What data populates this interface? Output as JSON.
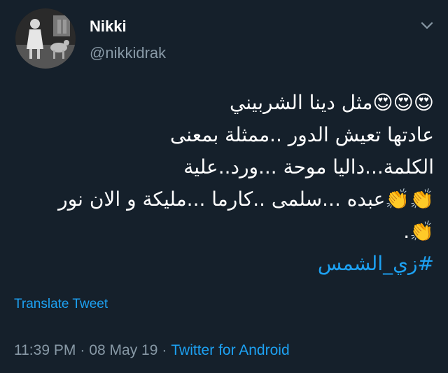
{
  "author": {
    "display_name": "Nikki",
    "handle": "@nikkidrak"
  },
  "tweet": {
    "lines": [
      {
        "text": "😍😍😍مثل دينا الشربيني"
      },
      {
        "text": "عادتها تعيش الدور ..ممثلة بمعنى"
      },
      {
        "text": "الكلمة...داليا موحة ...ورد..علية"
      },
      {
        "text": "👏👏عبده ...سلمى ..كارما ...مليكة و الان نور"
      },
      {
        "text": "👏."
      }
    ],
    "hashtag": "#زي_الشمس"
  },
  "translate_label": "Translate Tweet",
  "meta": {
    "time": "11:39 PM",
    "separator": "·",
    "date": "08 May 19",
    "source": "Twitter for Android"
  },
  "icons": {
    "caret": "chevron-down-icon"
  },
  "colors": {
    "background": "#15202b",
    "text_primary": "#ffffff",
    "text_secondary": "#8899a6",
    "accent": "#1da1f2"
  }
}
